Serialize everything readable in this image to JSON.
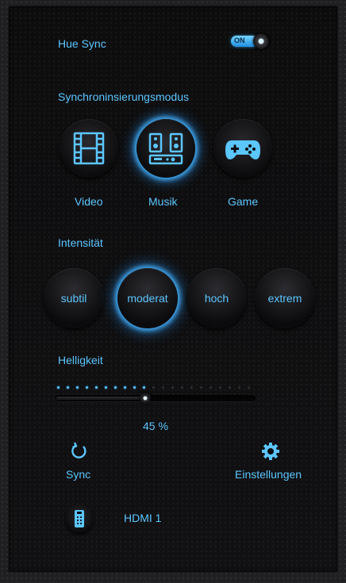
{
  "hue_sync": {
    "label": "Hue Sync",
    "toggle_text": "ON"
  },
  "sync_mode": {
    "title": "Synchroninsierungsmodus",
    "modes": [
      {
        "label": "Video",
        "icon": "film-icon",
        "active": false
      },
      {
        "label": "Musik",
        "icon": "speakers-icon",
        "active": true
      },
      {
        "label": "Game",
        "icon": "gamepad-icon",
        "active": false
      }
    ]
  },
  "intensity": {
    "title": "Intensität",
    "levels": [
      {
        "label": "subtil",
        "active": false
      },
      {
        "label": "moderat",
        "active": true
      },
      {
        "label": "hoch",
        "active": false
      },
      {
        "label": "extrem",
        "active": false
      }
    ]
  },
  "brightness": {
    "title": "Helligkeit",
    "value": 45,
    "value_text": "45 %"
  },
  "actions": {
    "sync_label": "Sync",
    "settings_label": "Einstellungen"
  },
  "source": {
    "label": "HDMI 1",
    "icon": "remote-icon"
  },
  "colors": {
    "accent": "#5cc6ff",
    "glow": "#46b4ff",
    "background": "#0d0d0e"
  }
}
